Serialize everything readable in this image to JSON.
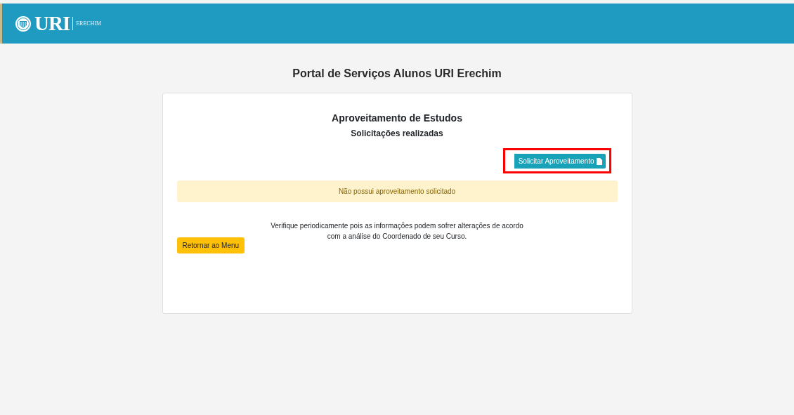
{
  "header": {
    "logo_text": "URI",
    "campus": "ERECHIM"
  },
  "page_title": "Portal de Serviços Alunos URI Erechim",
  "card": {
    "title": "Aproveitamento de Estudos",
    "subtitle": "Solicitações realizadas",
    "request_button": {
      "label": "Solicitar Aproveitamento",
      "highlighted": true
    },
    "alert": "Não possui aproveitamento solicitado",
    "note_lines": [
      "Verifique periodicamente pois as informações podem sofrer alterações de acordo",
      "com a análise do Coordenado de seu Curso."
    ],
    "back_button": "Retornar ao Menu"
  }
}
